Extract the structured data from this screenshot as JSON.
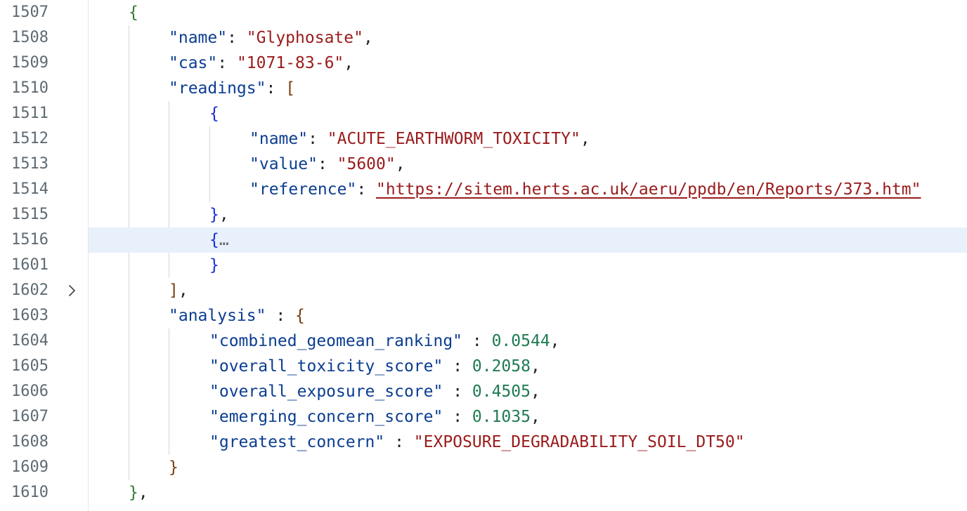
{
  "editor": {
    "lines": [
      {
        "num": "1507"
      },
      {
        "num": "1508",
        "key": "\"name\"",
        "value": "\"Glyphosate\""
      },
      {
        "num": "1509",
        "key": "\"cas\"",
        "value": "\"1071-83-6\""
      },
      {
        "num": "1510",
        "key": "\"readings\""
      },
      {
        "num": "1511"
      },
      {
        "num": "1512",
        "key": "\"name\"",
        "value": "\"ACUTE_EARTHWORM_TOXICITY\""
      },
      {
        "num": "1513",
        "key": "\"value\"",
        "value": "\"5600\""
      },
      {
        "num": "1514",
        "key": "\"reference\"",
        "value": "\"https://sitem.herts.ac.uk/aeru/ppdb/en/Reports/373.htm\""
      },
      {
        "num": "1515"
      },
      {
        "num": "1516",
        "collapsed": "…"
      },
      {
        "num": "1601"
      },
      {
        "num": "1602"
      },
      {
        "num": "1603",
        "key": "\"analysis\""
      },
      {
        "num": "1604",
        "key": "\"combined_geomean_ranking\"",
        "value": "0.0544"
      },
      {
        "num": "1605",
        "key": "\"overall_toxicity_score\"",
        "value": "0.2058"
      },
      {
        "num": "1606",
        "key": "\"overall_exposure_score\"",
        "value": "0.4505"
      },
      {
        "num": "1607",
        "key": "\"emerging_concern_score\"",
        "value": "0.1035"
      },
      {
        "num": "1608",
        "key": "\"greatest_concern\"",
        "value": "\"EXPOSURE_DEGRADABILITY_SOIL_DT50\""
      },
      {
        "num": "1609"
      },
      {
        "num": "1610"
      }
    ],
    "highlighted_line": "1516",
    "fold_icon": "chevron-right-icon",
    "colors": {
      "key": "#0b3d91",
      "string": "#9a1b1b",
      "number": "#1f7a52",
      "highlight": "#e8f0fb"
    }
  }
}
